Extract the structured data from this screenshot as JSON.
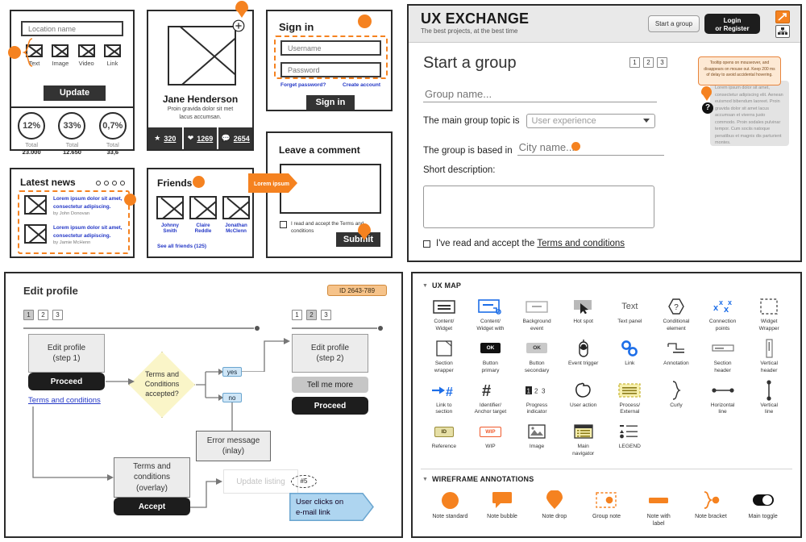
{
  "wireframe": {
    "location_card": {
      "input_placeholder": "Location name",
      "media_items": [
        {
          "label": "Text"
        },
        {
          "label": "Image"
        },
        {
          "label": "Video"
        },
        {
          "label": "Link"
        }
      ],
      "update_button": "Update"
    },
    "stats": [
      {
        "value": "12%",
        "total_label": "Total",
        "total_value": "23.000"
      },
      {
        "value": "33%",
        "total_label": "Total",
        "total_value": "12.650"
      },
      {
        "value": "0,7%",
        "total_label": "Total",
        "total_value": "33,6"
      }
    ],
    "profile": {
      "name": "Jane Henderson",
      "bio_line1": "Proin gravida dolor sit met",
      "bio_line2": "lacus accumsan.",
      "stats": [
        {
          "icon": "star-icon",
          "value": "320"
        },
        {
          "icon": "heart-icon",
          "value": "1269"
        },
        {
          "icon": "comment-icon",
          "value": "2654"
        }
      ],
      "add_icon": "plus-circle-icon"
    },
    "signin": {
      "title": "Sign in",
      "username_placeholder": "Username",
      "password_placeholder": "Password",
      "forgot_link": "Forget password?",
      "create_link": "Create account",
      "submit_button": "Sign in"
    },
    "latest_news": {
      "title": "Latest news",
      "dots": 4,
      "items": [
        {
          "headline": "Lorem ipsum dolor sit amet, consectetur adipiscing.",
          "byline": "by John Donovan"
        },
        {
          "headline": "Lorem ipsum dolor sit amet, consectetur adipiscing.",
          "byline": "by Jamie McHenn"
        }
      ]
    },
    "friends": {
      "title": "Friends",
      "people": [
        {
          "first": "Johnny",
          "last": "Smith"
        },
        {
          "first": "Claire",
          "last": "Reddle"
        },
        {
          "first": "Jonathan",
          "last": "McClenn"
        }
      ],
      "see_all": "See all friends (125)"
    },
    "comment": {
      "title": "Leave a comment",
      "callout": "Lorem ipsum",
      "consent_line1": "I read and accept the Terms and",
      "consent_line2": "conditions",
      "submit_button": "Submit"
    }
  },
  "ux_exchange": {
    "brand": "UX EXCHANGE",
    "tagline": "The best projects, at the best time",
    "start_group_button": "Start a group",
    "login_line1": "Login",
    "login_line2": "or Register",
    "page_title": "Start a group",
    "steps": [
      "1",
      "2",
      "3"
    ],
    "group_name_placeholder": "Group name...",
    "topic_label": "The main group topic is",
    "topic_value": "User experience",
    "city_label": "The group is based in",
    "city_placeholder": "City name...",
    "description_label": "Short description:",
    "consent_text": "I've read and accept the ",
    "consent_link": "Terms and conditions",
    "tooltip_orange": "Tooltip opens on mouseover, and disappears on mouse out. Keep 200 ms of delay to avoid accidental hovering.",
    "tooltip_grey": "Lorem ipsum dolor sit amet, consectetur adipiscing elit. Aenean euismod bibendum laoreet. Proin gravida dolor sit amet lacus accumsan et viverra justo commodo. Proin sodales pulvinar tempor. Cum sociis natoque penatibus et magnis dis parturient montes."
  },
  "flowchart": {
    "title": "Edit profile",
    "id_badge": "ID 2643-789",
    "steps_left": [
      "1",
      "2",
      "3"
    ],
    "steps_right": [
      "1",
      "2",
      "3"
    ],
    "step1_box": "Edit profile\n(step 1)",
    "step1_box_l1": "Edit profile",
    "step1_box_l2": "(step 1)",
    "proceed_button": "Proceed",
    "terms_link": "Terms and conditions",
    "decision_l1": "Terms and",
    "decision_l2": "Conditions",
    "decision_l3": "accepted?",
    "yes_label": "yes",
    "no_label": "no",
    "step2_box_l1": "Edit profile",
    "step2_box_l2": "(step 2)",
    "tell_me_more": "Tell me more",
    "proceed_button_2": "Proceed",
    "error_l1": "Error message",
    "error_l2": "(inlay)",
    "overlay_l1": "Terms and",
    "overlay_l2": "conditions",
    "overlay_l3": "(overlay)",
    "accept_button": "Accept",
    "update_listing": "Update listing",
    "hash_badge": "#5",
    "user_action_l1": "User clicks on",
    "user_action_l2": "e-mail link"
  },
  "ux_map": {
    "section_title": "UX MAP",
    "items": [
      {
        "icon": "content-widget-icon",
        "l1": "Content/",
        "l2": "Widget"
      },
      {
        "icon": "content-widget-with-icon",
        "l1": "Content/",
        "l2": "Widget with"
      },
      {
        "icon": "background-event-icon",
        "l1": "Background",
        "l2": "event"
      },
      {
        "icon": "hot-spot-icon",
        "l1": "Hot spot",
        "l2": ""
      },
      {
        "icon": "text-panel-icon",
        "l1": "Text panel",
        "l2": ""
      },
      {
        "icon": "conditional-element-icon",
        "l1": "Conditional",
        "l2": "element"
      },
      {
        "icon": "connection-points-icon",
        "l1": "Connection",
        "l2": "points"
      },
      {
        "icon": "widget-wrapper-icon",
        "l1": "Widget",
        "l2": "Wrapper"
      },
      {
        "icon": "section-wrapper-icon",
        "l1": "Section",
        "l2": "wrapper"
      },
      {
        "icon": "button-primary-icon",
        "l1": "Button",
        "l2": "primary"
      },
      {
        "icon": "button-secondary-icon",
        "l1": "Button",
        "l2": "secondary"
      },
      {
        "icon": "event-trigger-icon",
        "l1": "Event trigger",
        "l2": ""
      },
      {
        "icon": "link-icon",
        "l1": "Link",
        "l2": ""
      },
      {
        "icon": "annotation-icon",
        "l1": "Annotation",
        "l2": ""
      },
      {
        "icon": "section-header-icon",
        "l1": "Section",
        "l2": "header"
      },
      {
        "icon": "vertical-header-icon",
        "l1": "Vertical",
        "l2": "header"
      },
      {
        "icon": "link-to-section-icon",
        "l1": "Link to",
        "l2": "section"
      },
      {
        "icon": "identifier-anchor-icon",
        "l1": "Identifier/",
        "l2": "Anchor target"
      },
      {
        "icon": "progress-indicator-icon",
        "l1": "Progress",
        "l2": "indicator"
      },
      {
        "icon": "user-action-icon",
        "l1": "User action",
        "l2": ""
      },
      {
        "icon": "process-external-icon",
        "l1": "Process/",
        "l2": "External"
      },
      {
        "icon": "curly-icon",
        "l1": "Curly",
        "l2": ""
      },
      {
        "icon": "horizontal-line-icon",
        "l1": "Horizontal",
        "l2": "line"
      },
      {
        "icon": "vertical-line-icon",
        "l1": "Vertical",
        "l2": "line"
      },
      {
        "icon": "reference-icon",
        "l1": "Reference",
        "l2": ""
      },
      {
        "icon": "wip-icon",
        "l1": "WIP",
        "l2": ""
      },
      {
        "icon": "image-icon",
        "l1": "Image",
        "l2": ""
      },
      {
        "icon": "main-navigator-icon",
        "l1": "Main",
        "l2": "navigator"
      },
      {
        "icon": "legend-icon",
        "l1": "LEGEND",
        "l2": ""
      }
    ],
    "text_panel_glyph": "Text",
    "button_primary_glyph": "OK",
    "button_secondary_glyph": "OK",
    "reference_glyph": "ID",
    "wip_glyph": "WIP",
    "progress_glyph": "1 2 3",
    "annotations_title": "WIREFRAME ANNOTATIONS",
    "annotations": [
      {
        "icon": "note-standard-icon",
        "l1": "Note standard",
        "l2": ""
      },
      {
        "icon": "note-bubble-icon",
        "l1": "Note bubble",
        "l2": ""
      },
      {
        "icon": "note-drop-icon",
        "l1": "Note drop",
        "l2": ""
      },
      {
        "icon": "group-note-icon",
        "l1": "Group note",
        "l2": ""
      },
      {
        "icon": "note-with-label-icon",
        "l1": "Note with",
        "l2": "label"
      },
      {
        "icon": "note-bracket-icon",
        "l1": "Note bracket",
        "l2": ""
      },
      {
        "icon": "main-toggle-icon",
        "l1": "Main toggle",
        "l2": ""
      }
    ]
  },
  "colors": {
    "orange": "#F58220",
    "dark": "#1d1d1d",
    "blue_link": "#2337C6",
    "flow_blue": "#aed5f0",
    "flow_yellow": "#FAF5C8"
  }
}
